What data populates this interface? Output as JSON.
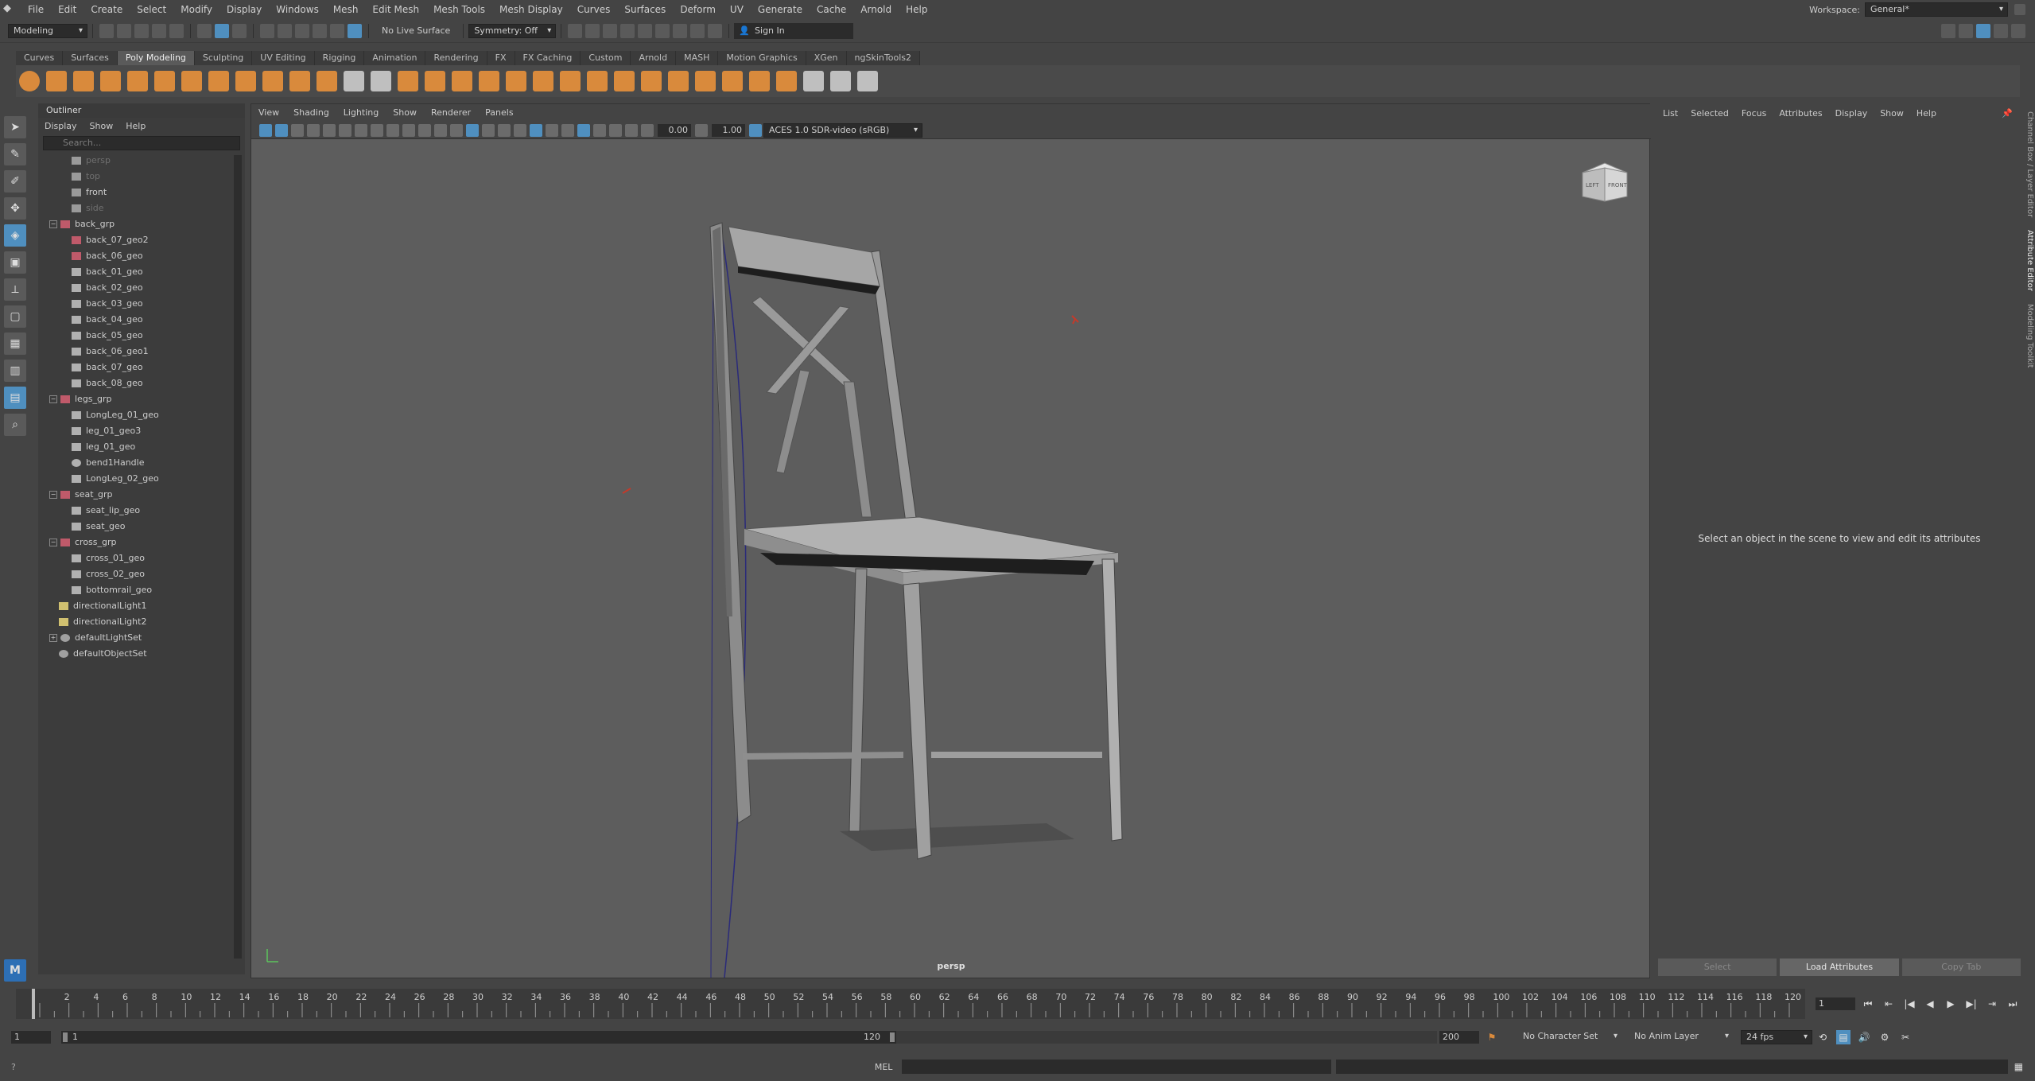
{
  "menubar": {
    "items": [
      "File",
      "Edit",
      "Create",
      "Select",
      "Modify",
      "Display",
      "Windows",
      "Mesh",
      "Edit Mesh",
      "Mesh Tools",
      "Mesh Display",
      "Curves",
      "Surfaces",
      "Deform",
      "UV",
      "Generate",
      "Cache",
      "Arnold",
      "Help"
    ],
    "workspace_label": "Workspace:",
    "workspace_value": "General*"
  },
  "statusline": {
    "mode": "Modeling",
    "live_surface": "No Live Surface",
    "symmetry": "Symmetry: Off",
    "sign_in": "Sign In"
  },
  "shelf": {
    "tabs": [
      "Curves",
      "Surfaces",
      "Poly Modeling",
      "Sculpting",
      "UV Editing",
      "Rigging",
      "Animation",
      "Rendering",
      "FX",
      "FX Caching",
      "Custom",
      "Arnold",
      "MASH",
      "Motion Graphics",
      "XGen",
      "ngSkinTools2"
    ],
    "active_tab": "Poly Modeling"
  },
  "outliner": {
    "title": "Outliner",
    "menu": [
      "Display",
      "Show",
      "Help"
    ],
    "search_placeholder": "Search...",
    "nodes": [
      {
        "label": "persp",
        "depth": 1,
        "dim": true,
        "type": "camera"
      },
      {
        "label": "top",
        "depth": 1,
        "dim": true,
        "type": "camera"
      },
      {
        "label": "front",
        "depth": 1,
        "dim": false,
        "type": "camera"
      },
      {
        "label": "side",
        "depth": 1,
        "dim": true,
        "type": "camera"
      },
      {
        "label": "back_grp",
        "depth": 0,
        "dim": false,
        "type": "group",
        "expanded": true
      },
      {
        "label": "back_07_geo2",
        "depth": 1,
        "dim": false,
        "type": "group"
      },
      {
        "label": "back_06_geo",
        "depth": 1,
        "dim": false,
        "type": "group"
      },
      {
        "label": "back_01_geo",
        "depth": 1,
        "dim": false,
        "type": "mesh"
      },
      {
        "label": "back_02_geo",
        "depth": 1,
        "dim": false,
        "type": "mesh"
      },
      {
        "label": "back_03_geo",
        "depth": 1,
        "dim": false,
        "type": "mesh"
      },
      {
        "label": "back_04_geo",
        "depth": 1,
        "dim": false,
        "type": "mesh"
      },
      {
        "label": "back_05_geo",
        "depth": 1,
        "dim": false,
        "type": "mesh"
      },
      {
        "label": "back_06_geo1",
        "depth": 1,
        "dim": false,
        "type": "mesh"
      },
      {
        "label": "back_07_geo",
        "depth": 1,
        "dim": false,
        "type": "mesh"
      },
      {
        "label": "back_08_geo",
        "depth": 1,
        "dim": false,
        "type": "mesh"
      },
      {
        "label": "legs_grp",
        "depth": 0,
        "dim": false,
        "type": "group",
        "expanded": true
      },
      {
        "label": "LongLeg_01_geo",
        "depth": 1,
        "dim": false,
        "type": "mesh"
      },
      {
        "label": "leg_01_geo3",
        "depth": 1,
        "dim": false,
        "type": "mesh"
      },
      {
        "label": "leg_01_geo",
        "depth": 1,
        "dim": false,
        "type": "mesh"
      },
      {
        "label": "bend1Handle",
        "depth": 1,
        "dim": false,
        "type": "deformer"
      },
      {
        "label": "LongLeg_02_geo",
        "depth": 1,
        "dim": false,
        "type": "mesh"
      },
      {
        "label": "seat_grp",
        "depth": 0,
        "dim": false,
        "type": "group",
        "expanded": true
      },
      {
        "label": "seat_lip_geo",
        "depth": 1,
        "dim": false,
        "type": "mesh"
      },
      {
        "label": "seat_geo",
        "depth": 1,
        "dim": false,
        "type": "mesh"
      },
      {
        "label": "cross_grp",
        "depth": 0,
        "dim": false,
        "type": "group",
        "expanded": true
      },
      {
        "label": "cross_01_geo",
        "depth": 1,
        "dim": false,
        "type": "mesh"
      },
      {
        "label": "cross_02_geo",
        "depth": 1,
        "dim": false,
        "type": "mesh"
      },
      {
        "label": "bottomrail_geo",
        "depth": 1,
        "dim": false,
        "type": "mesh"
      },
      {
        "label": "directionalLight1",
        "depth": 0,
        "dim": false,
        "type": "light"
      },
      {
        "label": "directionalLight2",
        "depth": 0,
        "dim": false,
        "type": "light"
      },
      {
        "label": "defaultLightSet",
        "depth": 0,
        "dim": false,
        "type": "set",
        "collapsed": true
      },
      {
        "label": "defaultObjectSet",
        "depth": 0,
        "dim": false,
        "type": "set"
      }
    ]
  },
  "viewport": {
    "menu": [
      "View",
      "Shading",
      "Lighting",
      "Show",
      "Renderer",
      "Panels"
    ],
    "exposure": "0.00",
    "gamma": "1.00",
    "color_space": "ACES 1.0 SDR-video (sRGB)",
    "camera_label": "persp",
    "viewcube_left": "LEFT",
    "viewcube_front": "FRONT"
  },
  "attribute_editor": {
    "menu": [
      "List",
      "Selected",
      "Focus",
      "Attributes",
      "Display",
      "Show",
      "Help"
    ],
    "message": "Select an object in the scene to view and edit its attributes",
    "buttons": [
      "Select",
      "Load Attributes",
      "Copy Tab"
    ],
    "side_tabs": [
      "Channel Box / Layer Editor",
      "Attribute Editor",
      "Modeling Toolkit"
    ]
  },
  "timeline": {
    "ticks": [
      "2",
      "4",
      "6",
      "8",
      "10",
      "12",
      "14",
      "16",
      "18",
      "20",
      "22",
      "24",
      "26",
      "28",
      "30",
      "32",
      "34",
      "36",
      "38",
      "40",
      "42",
      "44",
      "46",
      "48",
      "50",
      "52",
      "54",
      "56",
      "58",
      "60",
      "62",
      "64",
      "66",
      "68",
      "70",
      "72",
      "74",
      "76",
      "78",
      "80",
      "82",
      "84",
      "86",
      "88",
      "90",
      "92",
      "94",
      "96",
      "98",
      "100",
      "102",
      "104",
      "106",
      "108",
      "110",
      "112",
      "114",
      "116",
      "118",
      "120"
    ],
    "current_frame": "1"
  },
  "range": {
    "start": "1",
    "range_start": "1",
    "range_end_label": "120",
    "end": "200",
    "character_set": "No Character Set",
    "anim_layer": "No Anim Layer",
    "fps": "24 fps"
  },
  "cmdline": {
    "label": "MEL"
  }
}
